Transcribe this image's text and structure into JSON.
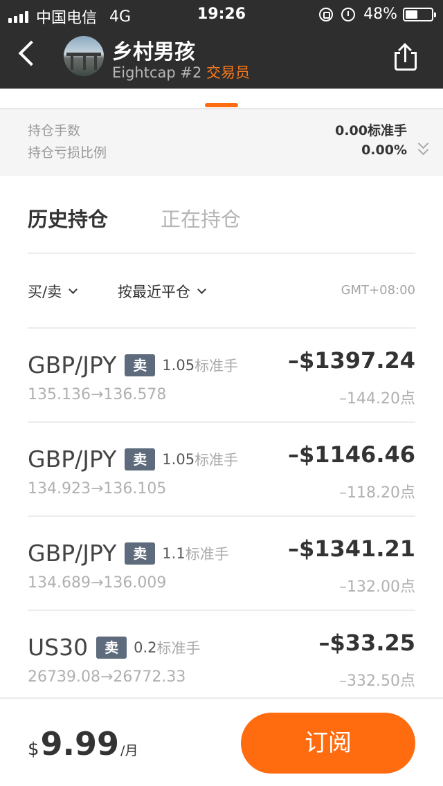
{
  "status_bar": {
    "carrier": "中国电信",
    "network": "4G",
    "time": "19:26",
    "battery_percent": "48%",
    "battery_level": 0.48
  },
  "header": {
    "trader_name": "乡村男孩",
    "broker_rank": "Eightcap #2",
    "role": "交易员"
  },
  "summary": {
    "lots_label": "持仓手数",
    "lots_value": "0.00标准手",
    "pnl_ratio_label": "持仓亏损比例",
    "pnl_ratio_value": "0.00%"
  },
  "tabs": {
    "history": "历史持仓",
    "open": "正在持仓"
  },
  "filters": {
    "side": "买/卖",
    "sort": "按最近平仓",
    "timezone": "GMT+08:00"
  },
  "trades": [
    {
      "symbol": "GBP/JPY",
      "side": "卖",
      "lots": "1.05",
      "lots_unit": "标准手",
      "prices": "135.136→136.578",
      "pnl": "–$1397.24",
      "points": "–144.20点"
    },
    {
      "symbol": "GBP/JPY",
      "side": "卖",
      "lots": "1.05",
      "lots_unit": "标准手",
      "prices": "134.923→136.105",
      "pnl": "–$1146.46",
      "points": "–118.20点"
    },
    {
      "symbol": "GBP/JPY",
      "side": "卖",
      "lots": "1.1",
      "lots_unit": "标准手",
      "prices": "134.689→136.009",
      "pnl": "–$1341.21",
      "points": "–132.00点"
    },
    {
      "symbol": "US30",
      "side": "卖",
      "lots": "0.2",
      "lots_unit": "标准手",
      "prices": "26739.08→26772.33",
      "pnl": "–$33.25",
      "points": "–332.50点"
    }
  ],
  "subscription": {
    "currency": "$",
    "price": "9.99",
    "period": "/月",
    "button_label": "订阅"
  },
  "colors": {
    "accent": "#ff6b0f",
    "header_bg": "#2e2e2e",
    "badge_bg": "#5d6b7c"
  }
}
